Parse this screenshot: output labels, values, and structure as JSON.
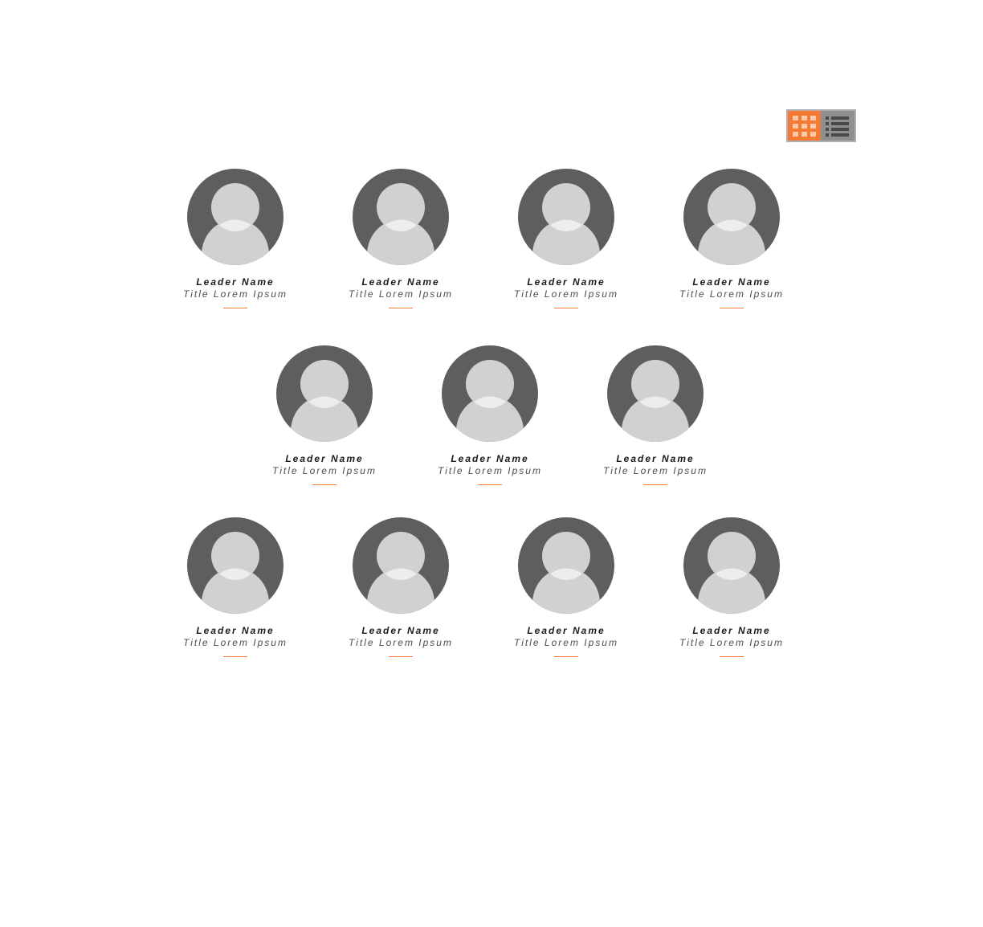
{
  "view_toggle": {
    "active": "grid",
    "options": [
      "grid",
      "list"
    ],
    "accent_color": "#f47a36",
    "inactive_color": "#8f8f8f"
  },
  "leaders": [
    {
      "name": "Leader Name",
      "title": "Title Lorem Ipsum"
    },
    {
      "name": "Leader Name",
      "title": "Title Lorem Ipsum"
    },
    {
      "name": "Leader Name",
      "title": "Title Lorem Ipsum"
    },
    {
      "name": "Leader Name",
      "title": "Title Lorem Ipsum"
    },
    {
      "name": "Leader Name",
      "title": "Title Lorem Ipsum"
    },
    {
      "name": "Leader Name",
      "title": "Title Lorem Ipsum"
    },
    {
      "name": "Leader Name",
      "title": "Title Lorem Ipsum"
    },
    {
      "name": "Leader Name",
      "title": "Title Lorem Ipsum"
    },
    {
      "name": "Leader Name",
      "title": "Title Lorem Ipsum"
    },
    {
      "name": "Leader Name",
      "title": "Title Lorem Ipsum"
    },
    {
      "name": "Leader Name",
      "title": "Title Lorem Ipsum"
    }
  ],
  "avatar_icon": "person-placeholder-icon"
}
